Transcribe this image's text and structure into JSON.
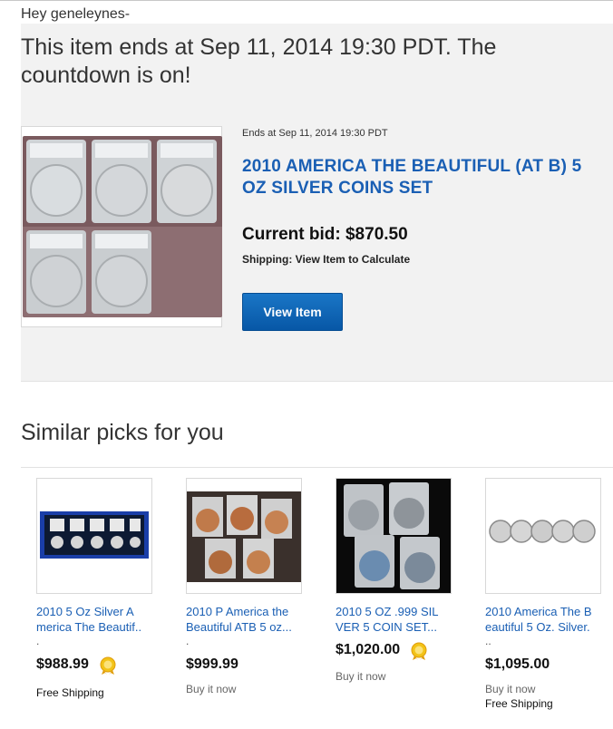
{
  "greeting": "Hey geneleynes-",
  "headline": "This item ends at Sep 11, 2014 19:30 PDT. The countdown is on!",
  "item": {
    "ends_text": "Ends at Sep 11, 2014 19:30 PDT",
    "title": "2010 AMERICA THE BEAUTIFUL (AT B) 5 OZ SILVER COINS SET",
    "current_bid": "Current bid: $870.50",
    "shipping": "Shipping:  View Item to Calculate",
    "view_button": "View Item"
  },
  "similar": {
    "heading": "Similar picks for you",
    "picks": [
      {
        "title": "2010 5 Oz Silver A merica The Beautif..",
        "dot": ".",
        "price": "$988.99",
        "note": "",
        "shipping": "Free Shipping",
        "badge": "top-rated-seller-icon"
      },
      {
        "title": "2010 P America the Beautiful ATB 5 oz...",
        "dot": ".",
        "price": "$999.99",
        "note": "Buy it now",
        "shipping": "",
        "badge": ""
      },
      {
        "title": "2010 5 OZ .999 SIL VER 5 COIN SET...",
        "dot": "",
        "price": "$1,020.00",
        "note": "Buy it now",
        "shipping": "",
        "badge": "top-rated-seller-icon"
      },
      {
        "title": "2010 America The B eautiful 5 Oz. Silver.",
        "dot": "..",
        "price": "$1,095.00",
        "note": "Buy it now",
        "shipping": "Free Shipping",
        "badge": ""
      }
    ]
  },
  "colors": {
    "link_blue": "#1a5fb4",
    "button_blue": "#0a63b4",
    "panel_gray": "#f2f2f2"
  }
}
